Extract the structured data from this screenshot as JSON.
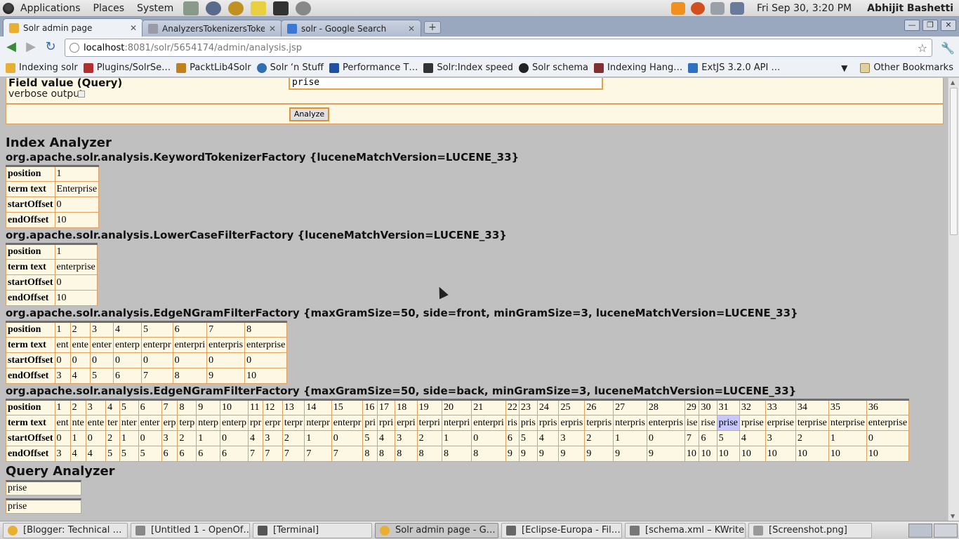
{
  "panel": {
    "menus": [
      "Applications",
      "Places",
      "System"
    ],
    "clock": "Fri Sep 30,  3:20 PM",
    "user": "Abhijit Bashetti"
  },
  "tabs": [
    {
      "label": "Solr admin page",
      "color": "#e8b030",
      "active": true
    },
    {
      "label": "AnalyzersTokenizersToken",
      "color": "#9a9aa8",
      "active": false
    },
    {
      "label": "solr - Google Search",
      "color": "#3a78d8",
      "active": false
    }
  ],
  "address": {
    "host": "localhost",
    "path": ":8081/solr/5654174/admin/analysis.jsp"
  },
  "bookmarks": [
    {
      "label": "Indexing solr",
      "color": "#e8b030"
    },
    {
      "label": "Plugins/SolrSe…",
      "color": "#b03030"
    },
    {
      "label": "PacktLib4Solr",
      "color": "#c08020"
    },
    {
      "label": "Solr ‘n Stuff",
      "color": "#3070b0"
    },
    {
      "label": "Performance T…",
      "color": "#2050a0"
    },
    {
      "label": "Solr:Index speed",
      "color": "#333333"
    },
    {
      "label": "Solr schema",
      "color": "#222222"
    },
    {
      "label": "Indexing Hang…",
      "color": "#803030"
    },
    {
      "label": "ExtJS 3.2.0 API …",
      "color": "#3070c0"
    }
  ],
  "other_bookmarks": "Other Bookmarks",
  "form": {
    "field_label": "Field value (Query)",
    "verbose_label": "verbose output",
    "query_value": "prise",
    "analyze_button": "Analyze"
  },
  "index_analyzer_title": "Index Analyzer",
  "query_analyzer_title": "Query Analyzer",
  "row_labels": [
    "position",
    "term text",
    "startOffset",
    "endOffset"
  ],
  "factories": [
    {
      "name": "org.apache.solr.analysis.KeywordTokenizerFactory {luceneMatchVersion=LUCENE_33}",
      "position": [
        "1"
      ],
      "term": [
        "Enterprise"
      ],
      "start": [
        "0"
      ],
      "end": [
        "10"
      ]
    },
    {
      "name": "org.apache.solr.analysis.LowerCaseFilterFactory {luceneMatchVersion=LUCENE_33}",
      "position": [
        "1"
      ],
      "term": [
        "enterprise"
      ],
      "start": [
        "0"
      ],
      "end": [
        "10"
      ]
    },
    {
      "name": "org.apache.solr.analysis.EdgeNGramFilterFactory {maxGramSize=50, side=front, minGramSize=3, luceneMatchVersion=LUCENE_33}",
      "position": [
        "1",
        "2",
        "3",
        "4",
        "5",
        "6",
        "7",
        "8"
      ],
      "term": [
        "ent",
        "ente",
        "enter",
        "enterp",
        "enterpr",
        "enterpri",
        "enterpris",
        "enterprise"
      ],
      "start": [
        "0",
        "0",
        "0",
        "0",
        "0",
        "0",
        "0",
        "0"
      ],
      "end": [
        "3",
        "4",
        "5",
        "6",
        "7",
        "8",
        "9",
        "10"
      ]
    },
    {
      "name": "org.apache.solr.analysis.EdgeNGramFilterFactory {maxGramSize=50, side=back, minGramSize=3, luceneMatchVersion=LUCENE_33}",
      "position": [
        "1",
        "2",
        "3",
        "4",
        "5",
        "6",
        "7",
        "8",
        "9",
        "10",
        "11",
        "12",
        "13",
        "14",
        "15",
        "16",
        "17",
        "18",
        "19",
        "20",
        "21",
        "22",
        "23",
        "24",
        "25",
        "26",
        "27",
        "28",
        "29",
        "30",
        "31",
        "32",
        "33",
        "34",
        "35",
        "36"
      ],
      "term": [
        "ent",
        "nte",
        "ente",
        "ter",
        "nter",
        "enter",
        "erp",
        "terp",
        "nterp",
        "enterp",
        "rpr",
        "erpr",
        "terpr",
        "nterpr",
        "enterpr",
        "pri",
        "rpri",
        "erpri",
        "terpri",
        "nterpri",
        "enterpri",
        "ris",
        "pris",
        "rpris",
        "erpris",
        "terpris",
        "nterpris",
        "enterpris",
        "ise",
        "rise",
        "prise",
        "rprise",
        "erprise",
        "terprise",
        "nterprise",
        "enterprise"
      ],
      "start": [
        "0",
        "1",
        "0",
        "2",
        "1",
        "0",
        "3",
        "2",
        "1",
        "0",
        "4",
        "3",
        "2",
        "1",
        "0",
        "5",
        "4",
        "3",
        "2",
        "1",
        "0",
        "6",
        "5",
        "4",
        "3",
        "2",
        "1",
        "0",
        "7",
        "6",
        "5",
        "4",
        "3",
        "2",
        "1",
        "0"
      ],
      "end": [
        "3",
        "4",
        "4",
        "5",
        "5",
        "5",
        "6",
        "6",
        "6",
        "6",
        "7",
        "7",
        "7",
        "7",
        "7",
        "8",
        "8",
        "8",
        "8",
        "8",
        "8",
        "9",
        "9",
        "9",
        "9",
        "9",
        "9",
        "9",
        "10",
        "10",
        "10",
        "10",
        "10",
        "10",
        "10",
        "10"
      ],
      "highlight_index": 30
    }
  ],
  "query_terms": [
    "prise",
    "prise"
  ],
  "taskbar": [
    {
      "label": "[Blogger: Technical …",
      "color": "#e8b030",
      "active": false
    },
    {
      "label": "[Untitled 1 - OpenOf…",
      "color": "#888888",
      "active": false
    },
    {
      "label": "[Terminal]",
      "color": "#555555",
      "active": false
    },
    {
      "label": "Solr admin page - G…",
      "color": "#e8b030",
      "active": true
    },
    {
      "label": "[Eclipse-Europa - Fil…",
      "color": "#666666",
      "active": false
    },
    {
      "label": "[schema.xml – KWrite]",
      "color": "#777777",
      "active": false
    },
    {
      "label": "[Screenshot.png]",
      "color": "#999999",
      "active": false
    }
  ]
}
